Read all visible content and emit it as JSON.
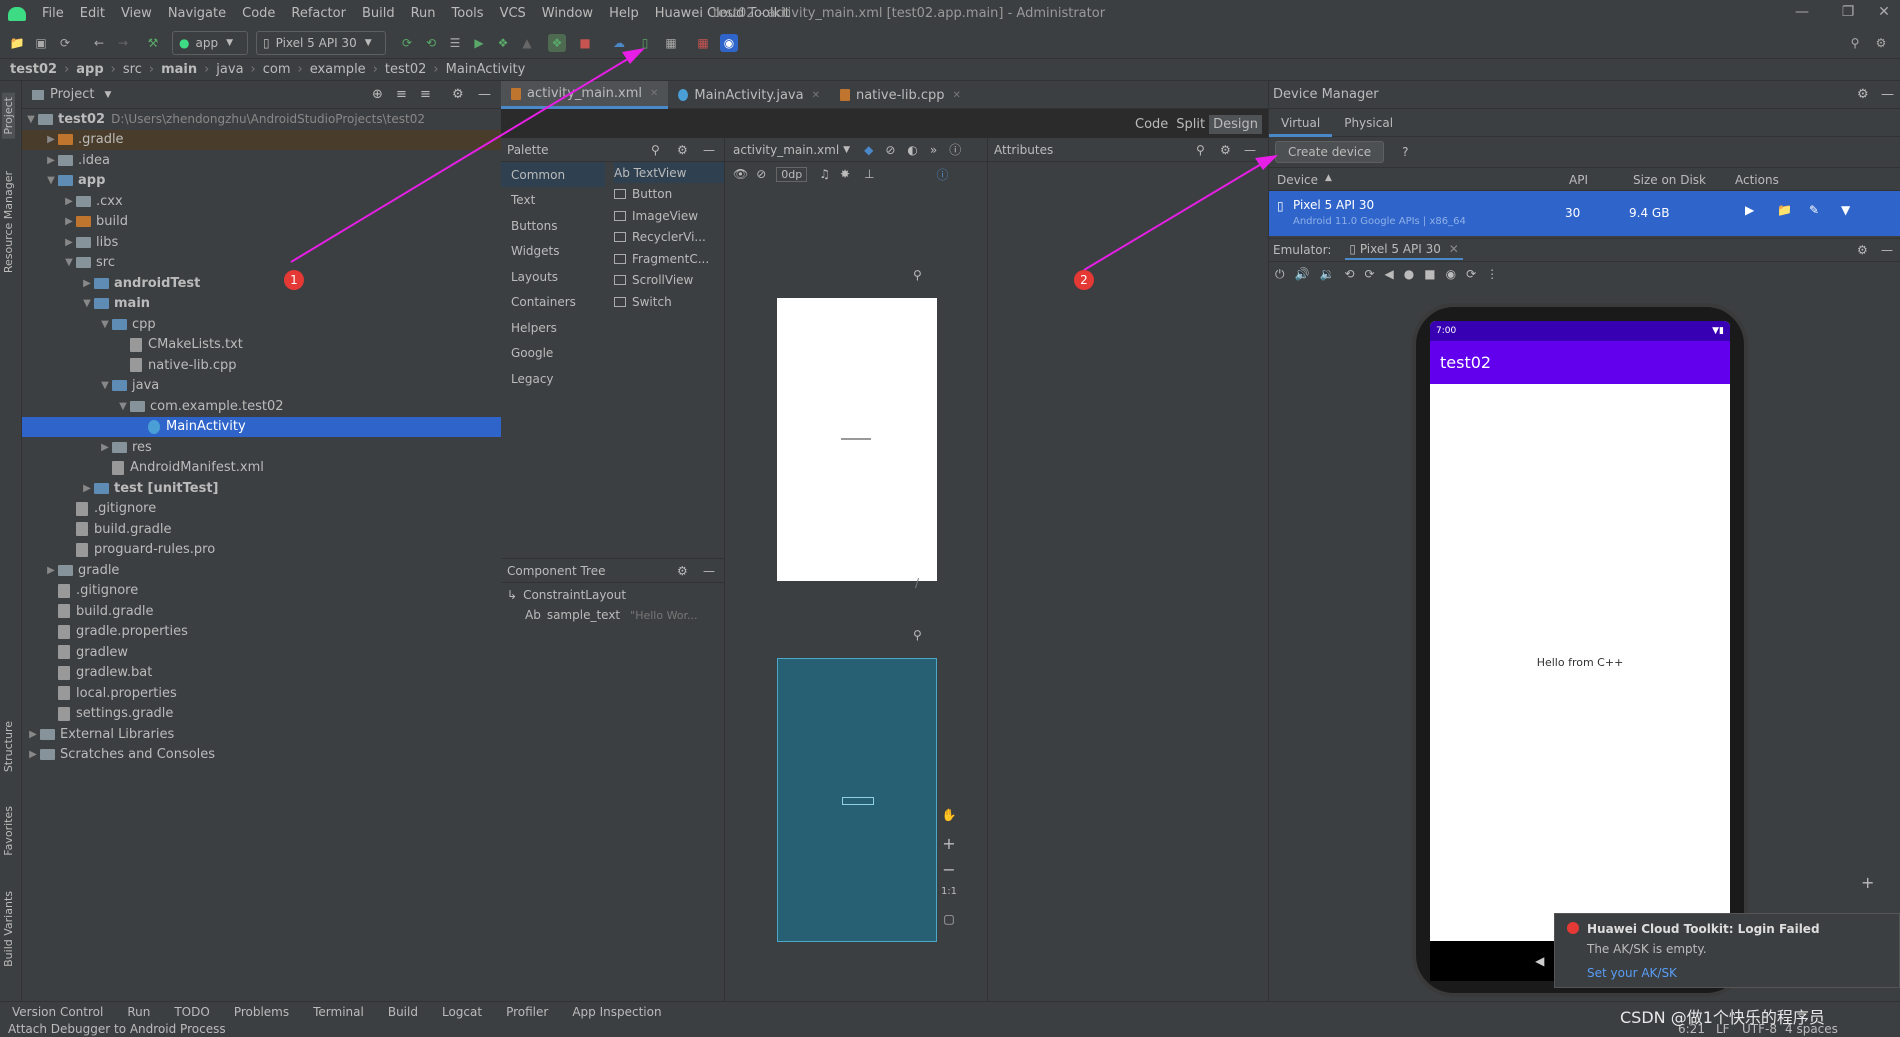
{
  "menu": {
    "items": [
      "File",
      "Edit",
      "View",
      "Navigate",
      "Code",
      "Refactor",
      "Build",
      "Run",
      "Tools",
      "VCS",
      "Window",
      "Help",
      "Huawei Cloud Toolkit"
    ],
    "window_title": "test02 - activity_main.xml [test02.app.main] - Administrator"
  },
  "toolbar": {
    "run_config": "app",
    "device": "Pixel 5 API 30"
  },
  "breadcrumb": [
    "test02",
    "app",
    "src",
    "main",
    "java",
    "com",
    "example",
    "test02",
    "MainActivity"
  ],
  "project": {
    "header": "Project",
    "root_name": "test02",
    "root_path": "D:\\Users\\zhendongzhu\\AndroidStudioProjects\\test02",
    "rows": [
      {
        "label": ".gradle",
        "indent": 1
      },
      {
        "label": ".idea",
        "indent": 1
      },
      {
        "label": "app",
        "indent": 1
      },
      {
        "label": ".cxx",
        "indent": 2
      },
      {
        "label": "build",
        "indent": 2
      },
      {
        "label": "libs",
        "indent": 2
      },
      {
        "label": "src",
        "indent": 2
      },
      {
        "label": "androidTest",
        "indent": 3
      },
      {
        "label": "main",
        "indent": 3
      },
      {
        "label": "cpp",
        "indent": 4
      },
      {
        "label": "CMakeLists.txt",
        "indent": 5
      },
      {
        "label": "native-lib.cpp",
        "indent": 5
      },
      {
        "label": "java",
        "indent": 4
      },
      {
        "label": "com.example.test02",
        "indent": 5
      },
      {
        "label": "MainActivity",
        "indent": 6
      },
      {
        "label": "res",
        "indent": 4
      },
      {
        "label": "AndroidManifest.xml",
        "indent": 4
      },
      {
        "label": "test [unitTest]",
        "indent": 3
      },
      {
        "label": ".gitignore",
        "indent": 2
      },
      {
        "label": "build.gradle",
        "indent": 2
      },
      {
        "label": "proguard-rules.pro",
        "indent": 2
      },
      {
        "label": "gradle",
        "indent": 1
      },
      {
        "label": ".gitignore",
        "indent": 1
      },
      {
        "label": "build.gradle",
        "indent": 1
      },
      {
        "label": "gradle.properties",
        "indent": 1
      },
      {
        "label": "gradlew",
        "indent": 1
      },
      {
        "label": "gradlew.bat",
        "indent": 1
      },
      {
        "label": "local.properties",
        "indent": 1
      },
      {
        "label": "settings.gradle",
        "indent": 1
      },
      {
        "label": "External Libraries",
        "indent": 0
      },
      {
        "label": "Scratches and Consoles",
        "indent": 0
      }
    ]
  },
  "side_tabs": [
    "Project",
    "Resource Manager",
    "Structure",
    "Favorites",
    "Build Variants"
  ],
  "editor": {
    "tabs": [
      "activity_main.xml",
      "MainActivity.java",
      "native-lib.cpp"
    ],
    "view_modes": [
      "Code",
      "Split",
      "Design"
    ]
  },
  "palette": {
    "title": "Palette",
    "categories": [
      "Common",
      "Text",
      "Buttons",
      "Widgets",
      "Layouts",
      "Containers",
      "Helpers",
      "Google",
      "Legacy"
    ],
    "items": [
      "Ab TextView",
      "Button",
      "ImageView",
      "RecyclerVi...",
      "FragmentC...",
      "ScrollView",
      "Switch"
    ]
  },
  "design": {
    "file_selector": "activity_main.xml",
    "margin": "0dp"
  },
  "attributes": {
    "title": "Attributes"
  },
  "component_tree": {
    "title": "Component Tree",
    "root": "ConstraintLayout",
    "child": "sample_text",
    "child_hint": "\"Hello Wor..."
  },
  "device_manager": {
    "title": "Device Manager",
    "tabs": [
      "Virtual",
      "Physical"
    ],
    "create_button": "Create device",
    "help": "?",
    "columns": [
      "Device",
      "API",
      "Size on Disk",
      "Actions"
    ],
    "device": {
      "name": "Pixel 5 API 30",
      "subtitle": "Android 11.0 Google APIs | x86_64",
      "api": "30",
      "size": "9.4 GB"
    }
  },
  "emulator": {
    "label": "Emulator:",
    "tab": "Pixel 5 API 30",
    "app_title": "test02",
    "screen_text": "Hello from C++",
    "status_time": "7:00"
  },
  "notification": {
    "title": "Huawei Cloud Toolkit: Login Failed",
    "body": "The AK/SK is empty.",
    "link": "Set your AK/SK"
  },
  "status_tabs": [
    "Version Control",
    "Run",
    "TODO",
    "Problems",
    "Terminal",
    "Build",
    "Logcat",
    "Profiler",
    "App Inspection"
  ],
  "bottom_status": "Attach Debugger to Android Process",
  "bottom_right": {
    "pos": "6:21",
    "lf": "LF",
    "enc": "UTF-8",
    "indent": "4 spaces"
  },
  "watermark": "CSDN @做1个快乐的程序员",
  "annotations": [
    "1",
    "2"
  ],
  "colors": {
    "accent": "#2f65ca",
    "app_bar": "#6200ee",
    "arrow": "#e61ee6",
    "selection": "#2f65ca"
  }
}
